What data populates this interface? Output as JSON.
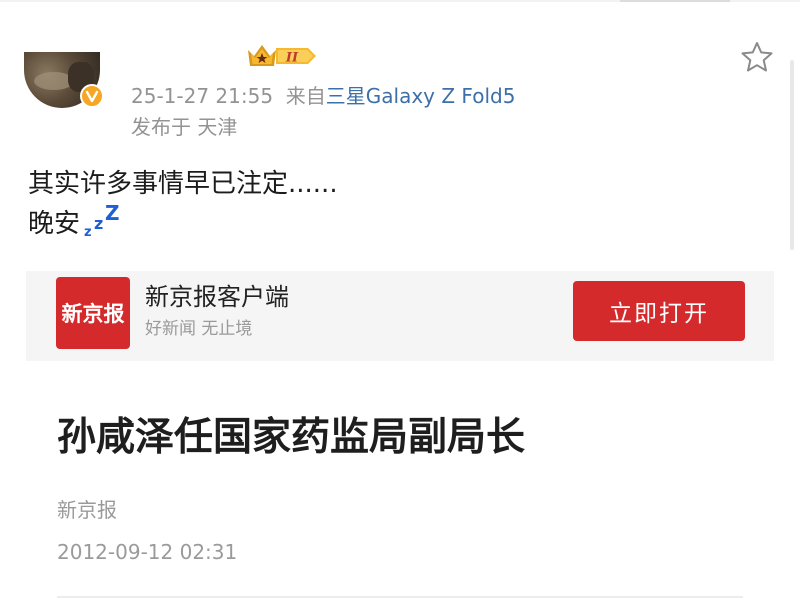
{
  "post": {
    "timestamp": "25-1-27 21:55",
    "source_prefix": "来自",
    "source_device": "三星Galaxy Z Fold5",
    "location": "发布于 天津",
    "text_line1": "其实许多事情早已注定......",
    "text_line2": "晚安",
    "vip_level": "II"
  },
  "app_banner": {
    "logo_text": "新京报",
    "app_name": "新京报客户端",
    "slogan": "好新闻 无止境",
    "open_button_label": "立即打开"
  },
  "article": {
    "title": "孙咸泽任国家药监局副局长",
    "source": "新京报",
    "datetime": "2012-09-12 02:31"
  },
  "colors": {
    "brand_red": "#d42a2b",
    "link_blue": "#3d6fa8",
    "meta_gray": "#939393",
    "zzz_blue": "#1f5fd6",
    "vip_gold": "#f5b82e"
  },
  "icons": {
    "star": "star-outline-icon",
    "verified": "verified-badge-icon",
    "vip": "vip-crown-icon",
    "sleep": "zzz-icon"
  }
}
